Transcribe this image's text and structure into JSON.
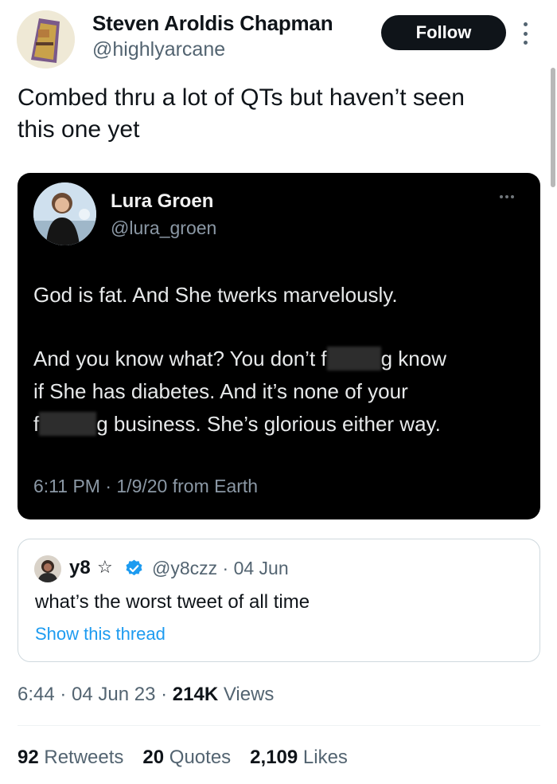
{
  "author": {
    "name": "Steven Aroldis Chapman",
    "handle": "@highlyarcane",
    "follow_label": "Follow"
  },
  "tweet": {
    "text_line1": "Combed thru a lot of QTs but haven’t seen",
    "text_line2": "this one yet"
  },
  "embedded_image": {
    "name": "Lura Groen",
    "handle": "@lura_groen",
    "line1": "God is fat.  And She twerks marvelously.",
    "line2_a": "And you know what? You don’t f",
    "line2_b": "g know",
    "line3": "if She has diabetes. And it’s none of your",
    "line4_a": "f",
    "line4_b": "g business. She’s glorious either way.",
    "meta": "6:11 PM · 1/9/20 from Earth"
  },
  "quoted": {
    "name": "y8",
    "star": "☆",
    "handle_date": "@y8czz · 04 Jun",
    "text": "what’s the worst tweet of all time",
    "link": "Show this thread"
  },
  "meta": {
    "time_date": "6:44 · 04 Jun 23 · ",
    "views_count": "214K",
    "views_label": " Views"
  },
  "stats": {
    "retweets_count": "92",
    "retweets_label": " Retweets",
    "quotes_count": "20",
    "quotes_label": " Quotes",
    "likes_count": "2,109",
    "likes_label": " Likes"
  },
  "colors": {
    "accent": "#1d9bf0",
    "text": "#0f1419",
    "secondary": "#536471",
    "follow_bg": "#0f1419"
  }
}
